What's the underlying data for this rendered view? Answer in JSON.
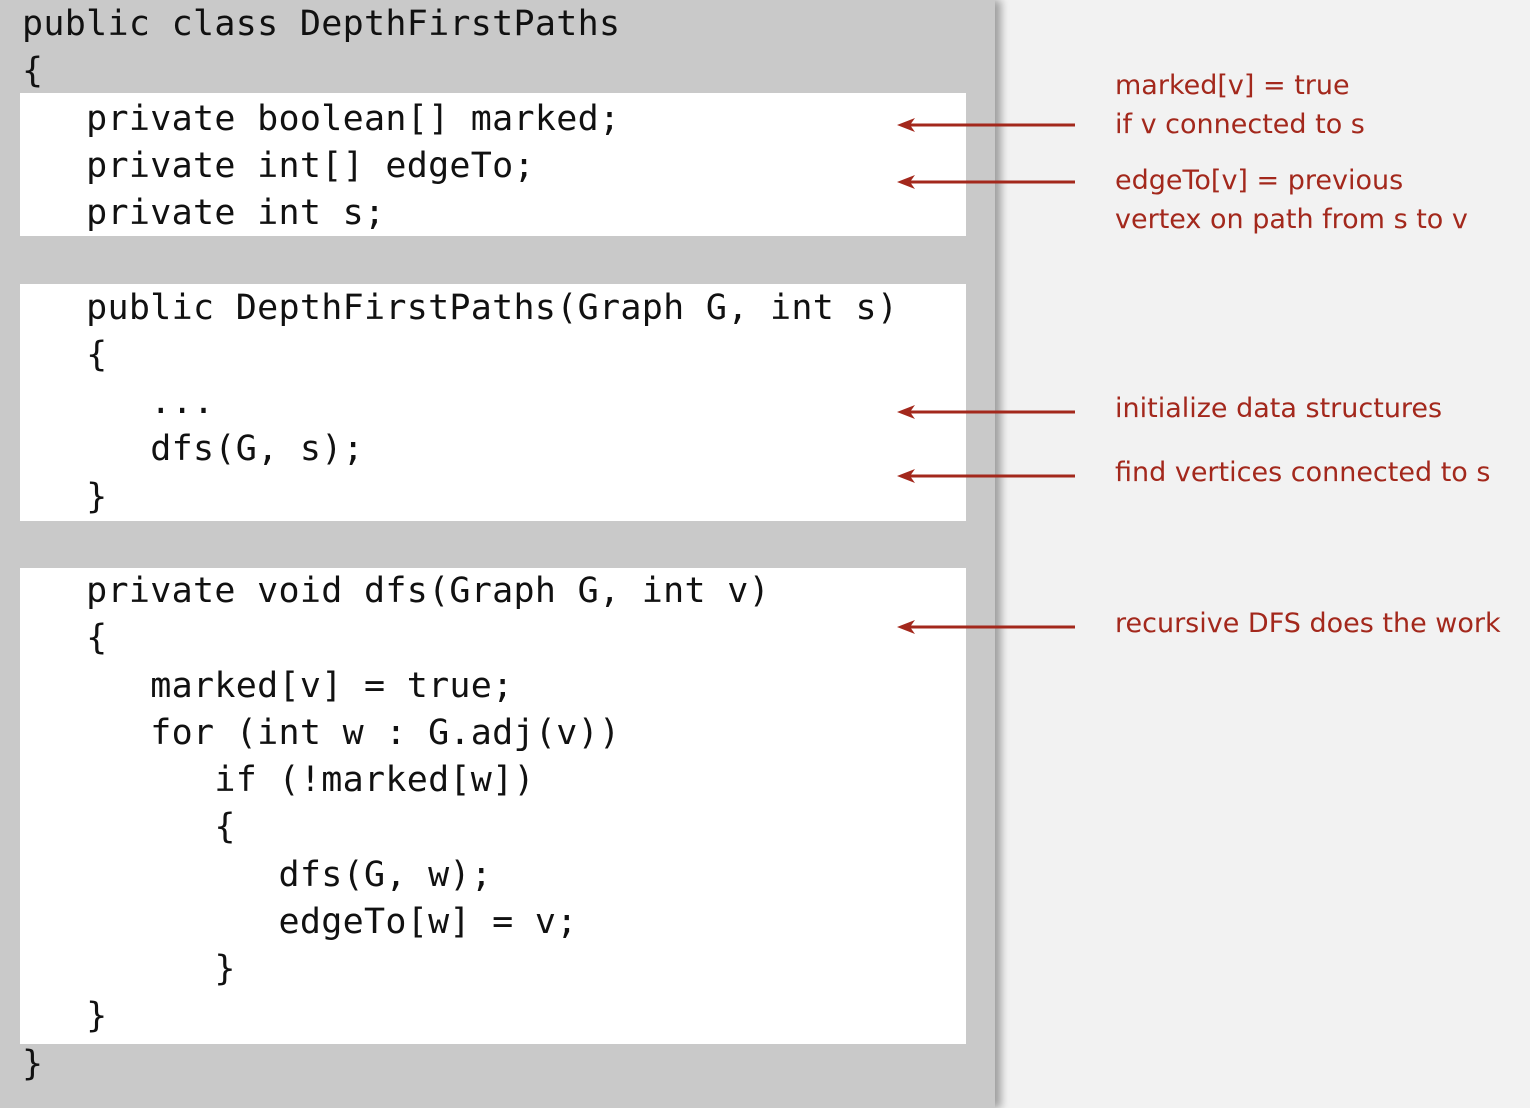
{
  "code_lines": [
    "public class DepthFirstPaths",
    "{",
    "   private boolean[] marked;",
    "   private int[] edgeTo;",
    "   private int s;",
    "",
    "   public DepthFirstPaths(Graph G, int s)",
    "   {",
    "      ...",
    "      dfs(G, s);",
    "   }",
    "",
    "   private void dfs(Graph G, int v)",
    "   {",
    "      marked[v] = true;",
    "      for (int w : G.adj(v))",
    "         if (!marked[w])",
    "         {",
    "            dfs(G, w);",
    "            edgeTo[w] = v;",
    "         }",
    "   }",
    "}"
  ],
  "annotations": [
    {
      "lines": [
        "marked[v] = true",
        "if v connected to s"
      ]
    },
    {
      "lines": [
        "edgeTo[v] = previous",
        "vertex on path from s to v"
      ]
    },
    {
      "lines": [
        "initialize data structures"
      ]
    },
    {
      "lines": [
        "find vertices connected to s"
      ]
    },
    {
      "lines": [
        "recursive DFS does the work"
      ]
    }
  ],
  "colors": {
    "annotation": "#a3281c",
    "panel": "#c9c9c9",
    "highlight": "#ffffff",
    "background": "#f2f2f2"
  }
}
